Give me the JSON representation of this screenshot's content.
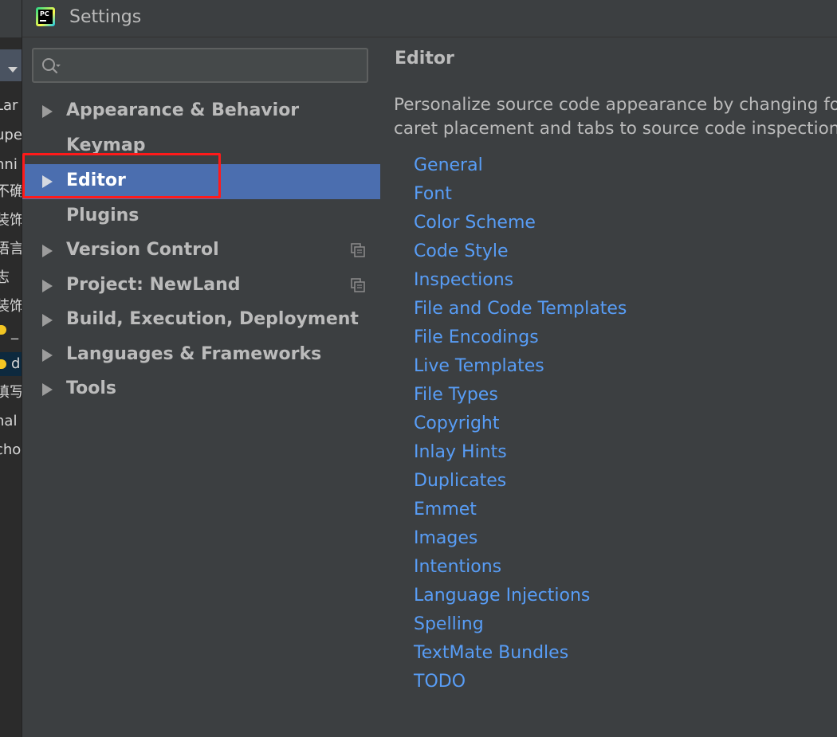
{
  "window": {
    "title": "Settings",
    "logo_text": "PC"
  },
  "search": {
    "value": "",
    "placeholder": ""
  },
  "background_ide": {
    "visible_fragments": [
      "Lar",
      "upe",
      "nni",
      "不确",
      "装饰",
      "语言",
      "志",
      "装饰",
      "_",
      "d",
      "填写",
      "nal",
      "cho"
    ]
  },
  "tree": {
    "items": [
      {
        "label": "Appearance & Behavior",
        "has_arrow": true,
        "selected": false,
        "project_icon": false
      },
      {
        "label": "Keymap",
        "has_arrow": false,
        "selected": false,
        "project_icon": false
      },
      {
        "label": "Editor",
        "has_arrow": true,
        "selected": true,
        "project_icon": false
      },
      {
        "label": "Plugins",
        "has_arrow": false,
        "selected": false,
        "project_icon": false
      },
      {
        "label": "Version Control",
        "has_arrow": true,
        "selected": false,
        "project_icon": true
      },
      {
        "label": "Project: NewLand",
        "has_arrow": true,
        "selected": false,
        "project_icon": true
      },
      {
        "label": "Build, Execution, Deployment",
        "has_arrow": true,
        "selected": false,
        "project_icon": false
      },
      {
        "label": "Languages & Frameworks",
        "has_arrow": true,
        "selected": false,
        "project_icon": false
      },
      {
        "label": "Tools",
        "has_arrow": true,
        "selected": false,
        "project_icon": false
      }
    ]
  },
  "content": {
    "title": "Editor",
    "description_line1": "Personalize source code appearance by changing fon",
    "description_line2": "caret placement and tabs to source code inspections",
    "links": [
      "General",
      "Font",
      "Color Scheme",
      "Code Style",
      "Inspections",
      "File and Code Templates",
      "File Encodings",
      "Live Templates",
      "File Types",
      "Copyright",
      "Inlay Hints",
      "Duplicates",
      "Emmet",
      "Images",
      "Intentions",
      "Language Injections",
      "Spelling",
      "TextMate Bundles",
      "TODO"
    ]
  },
  "colors": {
    "background": "#3c3f41",
    "selection": "#4b6eaf",
    "link": "#589df6",
    "highlight_box": "#ff1a1a"
  }
}
